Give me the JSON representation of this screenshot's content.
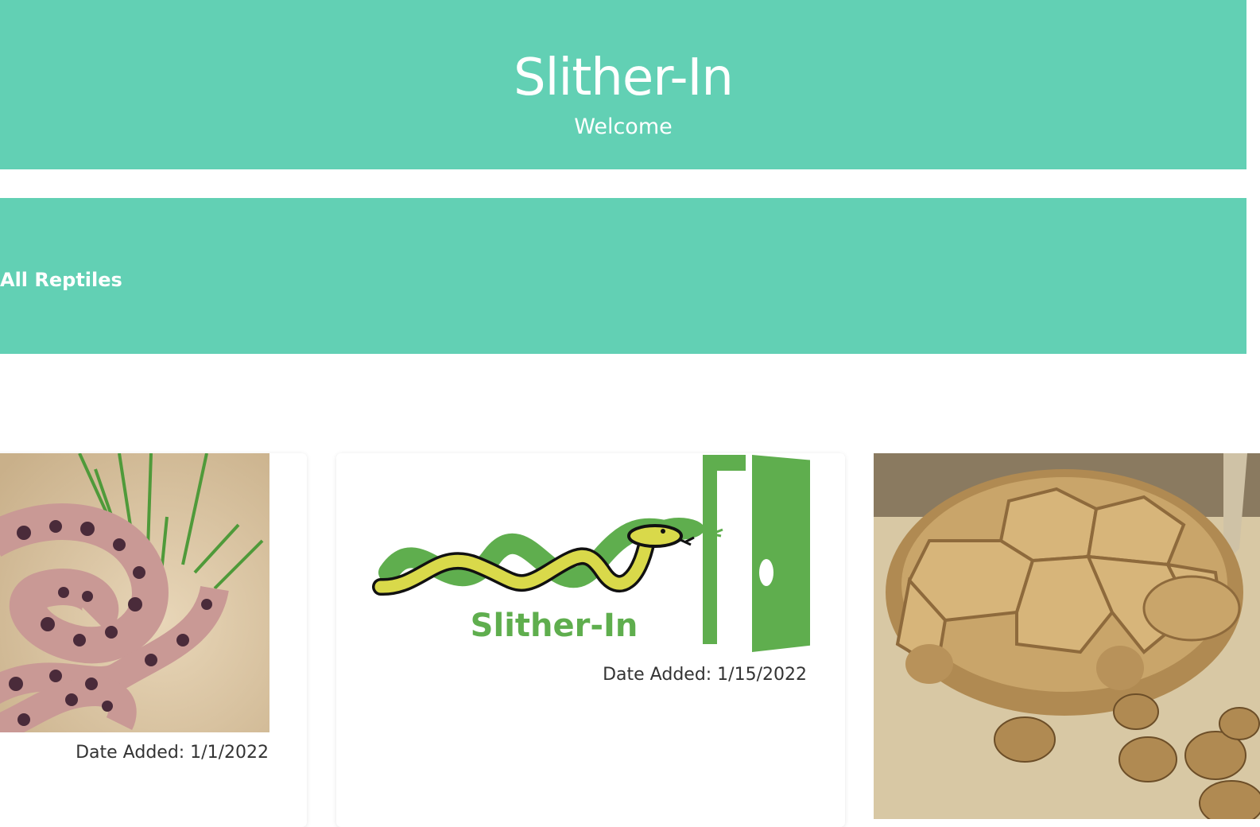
{
  "header": {
    "title": "Slither-In",
    "subtitle": "Welcome"
  },
  "section": {
    "title": "All Reptiles"
  },
  "cards": [
    {
      "image": "hognose-snake-photo",
      "date_label": "Date Added: 1/1/2022"
    },
    {
      "image": "slither-in-logo",
      "logo_text": "Slither-In",
      "date_label": "Date Added: 1/15/2022"
    },
    {
      "image": "tortoise-photo"
    }
  ],
  "colors": {
    "brand": "#62d0b4",
    "logo_green": "#5fae4e",
    "snake_yellow": "#d9d94a"
  }
}
